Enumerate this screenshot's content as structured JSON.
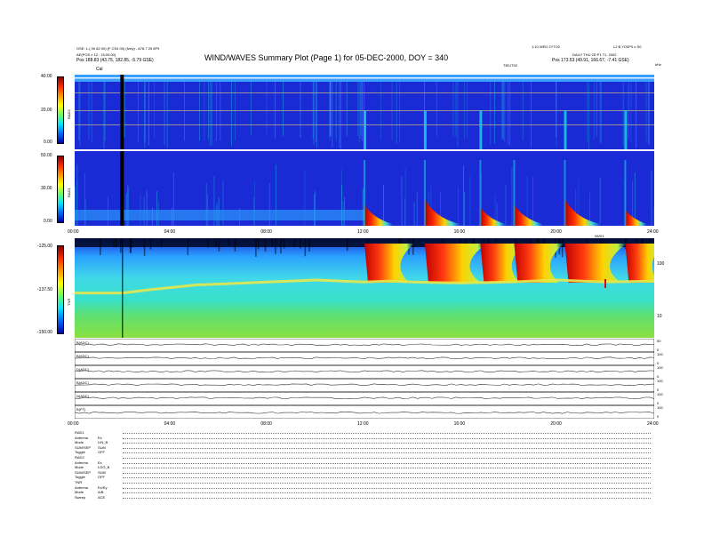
{
  "header": {
    "title": "WIND/WAVES Summary Plot (Page 1) for 05-DEC-2000, DOY = 340",
    "left_line1": "GSE: 1-( 00 82 00) (F CS4 00) (forty) - A78.7 25 6P9",
    "left_line2": "AE(POS ± 12 : 15:00:00)",
    "left_pos": "Pos     188.83 (43.75, 182.85, -5.79 GSE)",
    "right_line1": "1:10 WED 2YTO2",
    "right_line2": "DAILY THU 2D P1 T1, 2002",
    "right_pos": "Pos     173.53 (49.91, 166.67, -7.41 GSE)",
    "right_id": "L2 B YO0P0 o S0",
    "mid_label": "TIEUT52",
    "right_corner": "kHz",
    "cal_label": "Cal"
  },
  "colorbars": {
    "rad2": {
      "label": "RAD2",
      "ticks": [
        "40.00",
        "20.00",
        "0.00"
      ]
    },
    "rad1": {
      "label": "RAD1",
      "ticks": [
        "50.00",
        "30.00",
        "0.00"
      ]
    },
    "tnr": {
      "label": "TNR",
      "ticks": [
        "-125.00",
        "-137.50",
        "-150.00"
      ]
    }
  },
  "time_axis": {
    "upper": [
      "00:00",
      "04:00",
      "08:00",
      "12:00",
      "16:00",
      "20:00",
      "24:00"
    ],
    "lower": [
      "00:00",
      "04:00",
      "08:00",
      "12:00",
      "16:00",
      "20:00",
      "24:00"
    ],
    "tnr_top_label": "08/D1"
  },
  "tnr_axis": {
    "right_ticks": [
      "100",
      "10"
    ]
  },
  "traces": {
    "labels": [
      "B(ADC)",
      "B(ADC)",
      "D(ADC)",
      "B(ADC)",
      "N(ADC)",
      "B(FT)"
    ],
    "right_ticks": [
      [
        "50",
        "0"
      ],
      [
        "100",
        "0"
      ],
      [
        "100",
        "0"
      ],
      [
        "100",
        "0"
      ],
      [
        "100",
        "0"
      ],
      [
        "100",
        "0"
      ]
    ]
  },
  "footer": {
    "rows": [
      {
        "name": "RAD1",
        "value": ""
      },
      {
        "name": "Antenna",
        "value": "Ex"
      },
      {
        "name": "Mode",
        "value": "LIN_B"
      },
      {
        "name": "SUM/SEP",
        "value": "SUM"
      },
      {
        "name": "Toggle",
        "value": "OFF"
      },
      {
        "name": "RAD2",
        "value": ""
      },
      {
        "name": "Antenna",
        "value": "Ex"
      },
      {
        "name": "Mode",
        "value": "LOG_B"
      },
      {
        "name": "SUM/SEP",
        "value": "SUM"
      },
      {
        "name": "Toggle",
        "value": "OFF"
      },
      {
        "name": "TNR",
        "value": ""
      },
      {
        "name": "Antenna",
        "value": "Ex/Ey"
      },
      {
        "name": "Mode",
        "value": "A/B"
      },
      {
        "name": "Sweep",
        "value": "ACE"
      }
    ]
  },
  "colors": {
    "background": "#1a2bd6",
    "burst": "#e8201a",
    "cyan": "#19d8e6",
    "green": "#7ee05a"
  },
  "chart_data": [
    {
      "type": "heatmap",
      "title": "RAD2",
      "colorbar_ticks": [
        40.0,
        20.0,
        0.0
      ],
      "x_ticks": [
        "00:00",
        "04:00",
        "08:00",
        "12:00",
        "16:00",
        "20:00",
        "24:00"
      ],
      "features": [
        {
          "time_hr": 2.0,
          "kind": "cal"
        },
        {
          "time_hr": 12.0,
          "kind": "burst"
        },
        {
          "time_hr": 14.5,
          "kind": "burst"
        },
        {
          "time_hr": 16.8,
          "kind": "burst"
        },
        {
          "time_hr": 20.3,
          "kind": "burst"
        },
        {
          "time_hr": 22.8,
          "kind": "burst"
        }
      ]
    },
    {
      "type": "heatmap",
      "title": "RAD1",
      "colorbar_ticks": [
        50.0,
        30.0,
        0.0
      ],
      "x_ticks": [
        "00:00",
        "04:00",
        "08:00",
        "12:00",
        "16:00",
        "20:00",
        "24:00"
      ],
      "features": [
        {
          "time_hr": 12.0,
          "kind": "burst",
          "level": 0.8
        },
        {
          "time_hr": 14.5,
          "kind": "burst",
          "level": 1.0
        },
        {
          "time_hr": 16.8,
          "kind": "burst",
          "level": 0.7
        },
        {
          "time_hr": 18.2,
          "kind": "burst",
          "level": 0.8
        },
        {
          "time_hr": 20.3,
          "kind": "burst",
          "level": 1.0
        },
        {
          "time_hr": 22.8,
          "kind": "burst",
          "level": 0.6
        }
      ]
    },
    {
      "type": "heatmap",
      "title": "TNR",
      "colorbar_ticks": [
        -125.0,
        -137.5,
        -150.0
      ],
      "right_ticks": [
        100,
        10
      ],
      "features": [
        {
          "time_hr": 12.0,
          "kind": "burst",
          "level": 0.8
        },
        {
          "time_hr": 14.5,
          "kind": "burst",
          "level": 1.0
        },
        {
          "time_hr": 16.8,
          "kind": "burst",
          "level": 0.7
        },
        {
          "time_hr": 18.2,
          "kind": "burst",
          "level": 0.8
        },
        {
          "time_hr": 20.3,
          "kind": "burst",
          "level": 1.0
        },
        {
          "time_hr": 22.8,
          "kind": "burst",
          "level": 0.6
        }
      ],
      "plasma_line": [
        [
          0,
          0.55
        ],
        [
          2,
          0.55
        ],
        [
          3,
          0.52
        ],
        [
          5,
          0.47
        ],
        [
          6,
          0.46
        ],
        [
          8,
          0.44
        ],
        [
          9,
          0.43
        ],
        [
          10,
          0.42
        ],
        [
          12,
          0.44
        ],
        [
          13,
          0.43
        ],
        [
          14,
          0.44
        ],
        [
          16,
          0.45
        ],
        [
          18,
          0.44
        ],
        [
          20,
          0.42
        ],
        [
          22,
          0.44
        ],
        [
          24,
          0.43
        ]
      ]
    }
  ]
}
